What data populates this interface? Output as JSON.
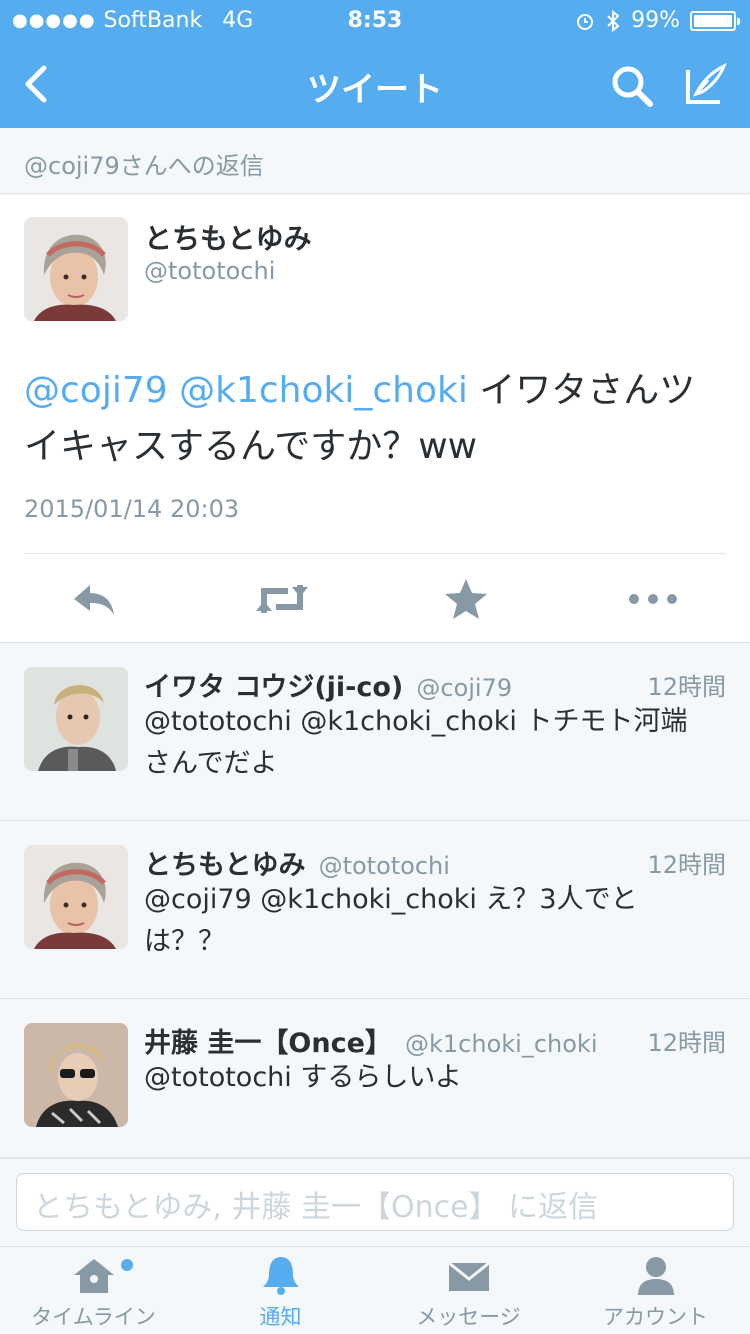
{
  "status_bar": {
    "carrier": "SoftBank",
    "network": "4G",
    "time": "8:53",
    "battery": "99%",
    "battery_level": 0.99
  },
  "nav": {
    "title": "ツイート"
  },
  "reply_to": "@coji79さんへの返信",
  "main_tweet": {
    "name": "とちもとゆみ",
    "handle": "@tototochi",
    "mention1": "@coji79",
    "mention2": "@k1choki_choki",
    "text": " イワタさんツイキャスするんですか？ww",
    "date": "2015/01/14 20:03"
  },
  "replies": [
    {
      "name": "イワタ コウジ(ji-co)",
      "handle": "@coji79",
      "time": "12時間",
      "text": "@tototochi @k1choki_choki トチモト河端さんでだよ"
    },
    {
      "name": "とちもとゆみ",
      "handle": "@tototochi",
      "time": "12時間",
      "text": "@coji79 @k1choki_choki え？3人でとは？？"
    },
    {
      "name": "井藤 圭一【Once】",
      "handle": "@k1choki_choki",
      "time": "12時間",
      "text": "@tototochi するらしいよ"
    }
  ],
  "compose": {
    "placeholder": "とちもとゆみ, 井藤 圭一【Once】 に返信"
  },
  "tabs": [
    {
      "label": "タイムライン",
      "icon": "home-icon",
      "active": false,
      "badge": true
    },
    {
      "label": "通知",
      "icon": "bell-icon",
      "active": true,
      "badge": false
    },
    {
      "label": "メッセージ",
      "icon": "envelope-icon",
      "active": false,
      "badge": false
    },
    {
      "label": "アカウント",
      "icon": "person-icon",
      "active": false,
      "badge": false
    }
  ],
  "colors": {
    "brand": "#55acee",
    "text": "#292f33",
    "muted": "#8899a6"
  }
}
